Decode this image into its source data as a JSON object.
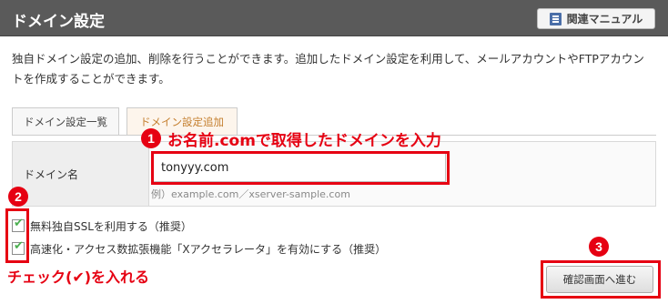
{
  "header": {
    "title": "ドメイン設定",
    "manual_label": "関連マニュアル"
  },
  "description": "独自ドメイン設定の追加、削除を行うことができます。追加したドメイン設定を利用して、メールアカウントやFTPアカウントを作成することができます。",
  "tabs": [
    {
      "label": "ドメイン設定一覧",
      "active": false
    },
    {
      "label": "ドメイン設定追加",
      "active": true
    }
  ],
  "form": {
    "domain_label": "ドメイン名",
    "domain_value": "tonyyy.com",
    "example": "例）example.com／xserver-sample.com"
  },
  "options": [
    {
      "label": "無料独自SSLを利用する（推奨）",
      "checked": true
    },
    {
      "label": "高速化・アクセス数拡張機能「Xアクセラレータ」を有効にする（推奨）",
      "checked": true
    }
  ],
  "confirm_label": "確認画面へ進む",
  "annotations": {
    "num1": "1",
    "text1": "お名前.comで取得したドメインを入力",
    "num2": "2",
    "text2": "チェック(✔)を入れる",
    "num3": "3"
  },
  "colors": {
    "annotation": "#e60012",
    "header_bg": "#5a5a5a",
    "active_tab_text": "#c47e2d",
    "check": "#4caf50"
  }
}
